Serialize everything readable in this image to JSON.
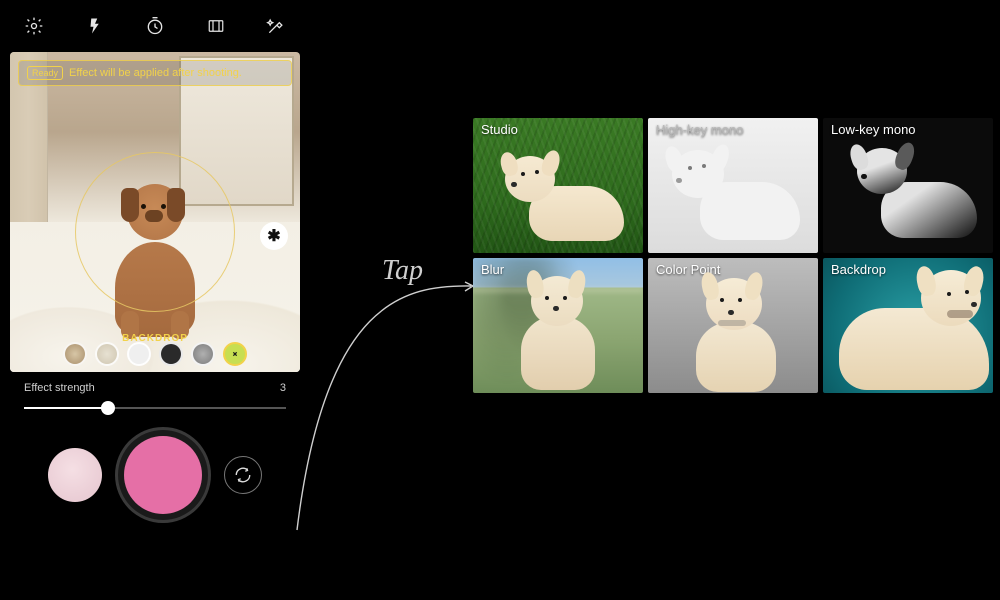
{
  "camera": {
    "banner_pill": "Ready",
    "banner_text": "Effect will be applied after shooting.",
    "selected_effect_label": "BACKDROP",
    "exposure_glyph": "✱",
    "slider_label": "Effect strength",
    "slider_value": "3",
    "icons": {
      "settings": "settings-icon",
      "flash": "flash-icon",
      "timer": "timer-icon",
      "ratio": "ratio-icon",
      "wand": "effects-icon"
    },
    "effect_dots": [
      "blur",
      "studio",
      "hk",
      "lk",
      "colorpoint",
      "backdrop"
    ],
    "selected_effect_index": 5
  },
  "annotation": {
    "label": "Tap"
  },
  "grid": {
    "tiles": [
      {
        "key": "studio",
        "label": "Studio"
      },
      {
        "key": "highkey",
        "label": "High-key mono"
      },
      {
        "key": "lowkey",
        "label": "Low-key mono"
      },
      {
        "key": "blur",
        "label": "Blur"
      },
      {
        "key": "colorpoint",
        "label": "Color Point"
      },
      {
        "key": "backdrop",
        "label": "Backdrop"
      }
    ]
  },
  "colors": {
    "accent_yellow": "#f2d24a",
    "shutter_pink": "#e56fa6"
  }
}
